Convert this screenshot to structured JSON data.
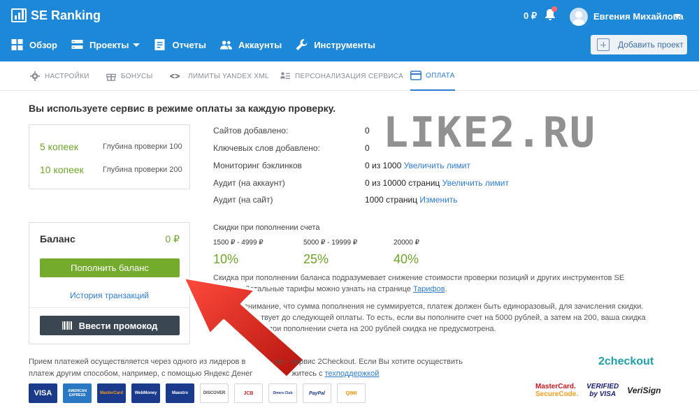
{
  "header": {
    "app_name": "SE Ranking",
    "balance": "0 ₽",
    "user_name": "Евгения Михайлова",
    "add_project_label": "Добавить проект"
  },
  "nav": {
    "items": [
      {
        "label": "Обзор",
        "icon": "grid-icon"
      },
      {
        "label": "Проекты",
        "icon": "projects-icon"
      },
      {
        "label": "Отчеты",
        "icon": "report-icon"
      },
      {
        "label": "Аккаунты",
        "icon": "users-icon"
      },
      {
        "label": "Инструменты",
        "icon": "wrench-icon"
      }
    ]
  },
  "subtabs": [
    {
      "label": "НАСТРОЙКИ",
      "icon": "gear-icon"
    },
    {
      "label": "БОНУСЫ",
      "icon": "gift-icon"
    },
    {
      "label": "ЛИМИТЫ YANDEX XML",
      "icon": "code-icon"
    },
    {
      "label": "ПЕРСОНАЛИЗАЦИЯ СЕРВИСА",
      "icon": "person-list-icon"
    },
    {
      "label": "ОПЛАТА",
      "icon": "card-icon"
    }
  ],
  "main": {
    "title": "Вы используете сервис в режиме оплаты за каждую проверку.",
    "prices": [
      {
        "amount": "5 копеек",
        "desc": "Глубина проверки 100"
      },
      {
        "amount": "10 копеек",
        "desc": "Глубина проверки 200"
      }
    ],
    "stats": [
      {
        "label": "Сайтов добавлено:",
        "value": "0",
        "link": ""
      },
      {
        "label": "Ключевых слов добавлено:",
        "value": "0",
        "link": ""
      },
      {
        "label": "Мониторинг бэклинков",
        "value": "0 из 1000",
        "link": "Увеличить лимит"
      },
      {
        "label": "Аудит (на аккаунт)",
        "value": "0 из 10000 страниц",
        "link": "Увеличить лимит"
      },
      {
        "label": "Аудит (на сайт)",
        "value": "1000 страниц",
        "link": "Изменить"
      }
    ],
    "balance": {
      "title": "Баланс",
      "value": "0 ₽",
      "topup_label": "Пополнить баланс",
      "history_label": "История транзакций",
      "promo_label": "Ввести промокод"
    },
    "discounts": {
      "title": "Скидки при пополнении счета",
      "tiers": [
        {
          "range": "1500 ₽ - 4999 ₽",
          "percent": "10%"
        },
        {
          "range": "5000 ₽ - 19999 ₽",
          "percent": "25%"
        },
        {
          "range": "20000 ₽",
          "percent": "40%"
        }
      ],
      "text1_a": "Скидка при пополнении баланса подразумевает снижение стоимости проверки позиций и других инструментов SE",
      "text1_b": "Детальные тарифы можно узнать на странице",
      "text1_link": "Тарифов",
      "text2_a": "внимание, что сумма пополнения не суммируется, платеж должен быть единоразовый, для зачисления скидки.",
      "text2_b": "твует до следующей оплаты. То есть, если вы пополните счет на 5000 рублей, а затем на 200, ваша скидка",
      "text2_c": "как при пополнении счета на 200 рублей скидка не предусмотрена."
    },
    "watermark": "LIKE2.RU"
  },
  "payment": {
    "note_a": "Прием платежей осуществляется через одного из лидеров в",
    "note_b": "се – сервис 2Checkout. Если Вы хотите осуществить",
    "note_c": "платеж другим способом, например, с помощью Яндекс Денег",
    "note_d": "житесь с",
    "note_link": "техподдержкой",
    "provider": "2checkout",
    "cards": [
      {
        "label": "VISA",
        "color": "#1a3a8c"
      },
      {
        "label": "AMERICAN EXPRESS",
        "color": "#2a78c4"
      },
      {
        "label": "MasterCard",
        "color": "#1a3a8c"
      },
      {
        "label": "WebMoney",
        "color": "#1a3a8c"
      },
      {
        "label": "Maestro",
        "color": "#1a3a8c"
      },
      {
        "label": "DISCOVER",
        "color": "#ffffff"
      },
      {
        "label": "JCB",
        "color": "#ffffff"
      },
      {
        "label": "Diners Club",
        "color": "#ffffff"
      },
      {
        "label": "PayPal",
        "color": "#ffffff"
      },
      {
        "label": "QIWI",
        "color": "#ffffff"
      }
    ],
    "badges": {
      "mastercard_a": "MasterCard.",
      "mastercard_b": "SecureCode.",
      "vbv_a": "VERIFIED",
      "vbv_b": "by VISA",
      "verisign": "VeriSign"
    }
  },
  "colors": {
    "header_bg": "#1e88d8",
    "accent_green": "#74ab2d",
    "link_blue": "#2e7cd1",
    "promo_dark": "#3a4753"
  }
}
